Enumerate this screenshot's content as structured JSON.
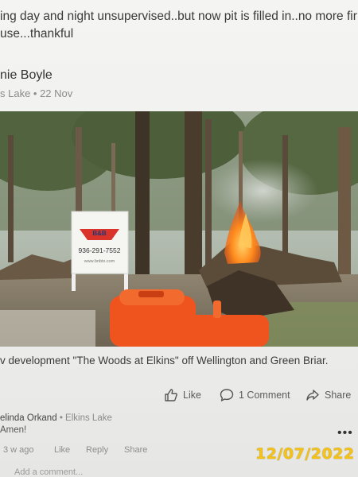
{
  "previous_post": {
    "line1": "ing day and night unsupervised..but now pit is filled in..no more fir",
    "line2": "use...thankful"
  },
  "post": {
    "author": "nie Boyle",
    "meta": "s Lake • 22 Nov",
    "photo": {
      "sign_logo": "B&B",
      "sign_phone": "936-291-7552",
      "sign_url": "www.bnbtx.com"
    },
    "caption": "v development \"The Woods at Elkins\" off Wellington and Green Briar."
  },
  "actions": {
    "like_label": "Like",
    "comment_label": "1 Comment",
    "share_label": "Share"
  },
  "comment": {
    "author": "elinda Orkand",
    "location": "Elkins Lake",
    "text": "Amen!",
    "time": "3 w ago",
    "like": "Like",
    "reply": "Reply",
    "share": "Share",
    "more": "•••",
    "add_placeholder": "Add a comment..."
  },
  "timestamp_overlay": "12/07/2022",
  "colors": {
    "timestamp": "#f5c316",
    "fire": "#ff7a1a",
    "container": "#f0541e"
  }
}
